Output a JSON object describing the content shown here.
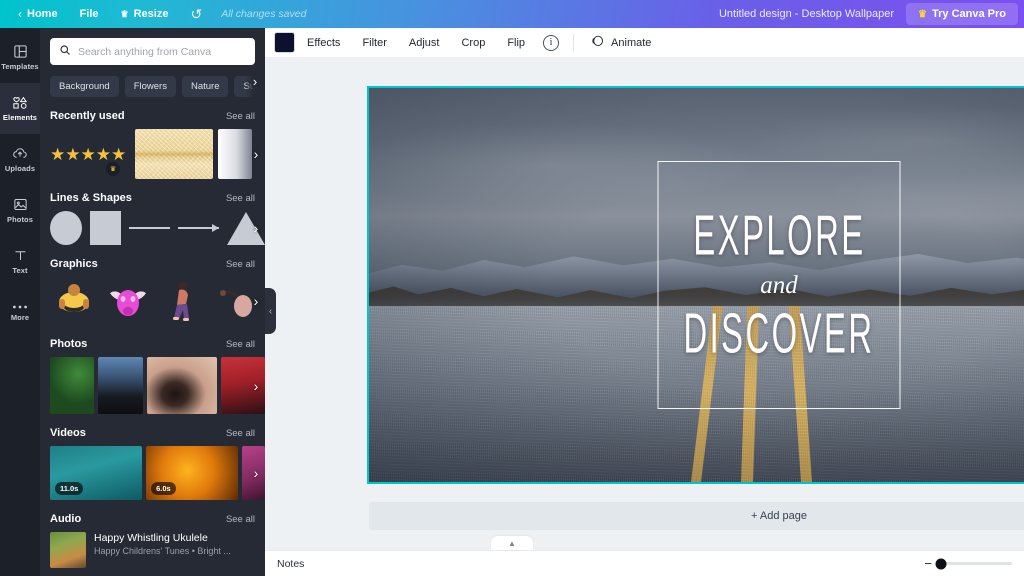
{
  "topbar": {
    "back_icon": "chevron-left-icon",
    "home_label": "Home",
    "file_label": "File",
    "resize_label": "Resize",
    "resize_icon": "crown-icon",
    "undo_icon": "undo-icon",
    "status_text": "All changes saved",
    "doc_title": "Untitled design - Desktop Wallpaper",
    "pro_label": "Try Canva Pro",
    "pro_icon": "crown-icon",
    "gradient_from": "#00c4cc",
    "gradient_to": "#7b4ff0"
  },
  "rail": {
    "items": [
      {
        "label": "Templates",
        "icon": "templates-icon",
        "active": false
      },
      {
        "label": "Elements",
        "icon": "elements-icon",
        "active": true
      },
      {
        "label": "Uploads",
        "icon": "uploads-icon",
        "active": false
      },
      {
        "label": "Photos",
        "icon": "photos-icon",
        "active": false
      },
      {
        "label": "Text",
        "icon": "text-icon",
        "active": false
      },
      {
        "label": "More",
        "icon": "more-icon",
        "active": false
      }
    ]
  },
  "panel": {
    "search": {
      "placeholder": "Search anything from Canva",
      "value": "",
      "icon": "search-icon"
    },
    "chips": [
      "Background",
      "Flowers",
      "Nature",
      "Summer"
    ],
    "chips_next_icon": "chevron-right-icon",
    "see_all_label": "See all",
    "sections": {
      "recently_used": {
        "title": "Recently used",
        "stars_count": "★★★★★",
        "crown_badge": "♛"
      },
      "lines_shapes": {
        "title": "Lines & Shapes"
      },
      "graphics": {
        "title": "Graphics"
      },
      "photos": {
        "title": "Photos"
      },
      "videos": {
        "title": "Videos",
        "durations": [
          "11.0s",
          "6.0s"
        ]
      },
      "audio": {
        "title": "Audio",
        "track_title": "Happy Whistling Ukulele",
        "track_sub": "Happy Childrens' Tunes • Bright ..."
      }
    },
    "collapse_icon": "chevron-left-icon"
  },
  "toolbar": {
    "swatch_color": "#0d1130",
    "effects_label": "Effects",
    "filter_label": "Filter",
    "adjust_label": "Adjust",
    "crop_label": "Crop",
    "flip_label": "Flip",
    "info_icon": "info-icon",
    "animate_label": "Animate",
    "animate_icon": "animate-icon"
  },
  "canvas": {
    "selection_color": "#00c4cc",
    "headline_top": "EXPLORE",
    "headline_mid": "and",
    "headline_bottom": "DISCOVER",
    "add_page_label": "+ Add page"
  },
  "statusbar": {
    "notes_label": "Notes",
    "zoom_minus": "−",
    "notes_tab_icon": "chevron-up-icon"
  }
}
